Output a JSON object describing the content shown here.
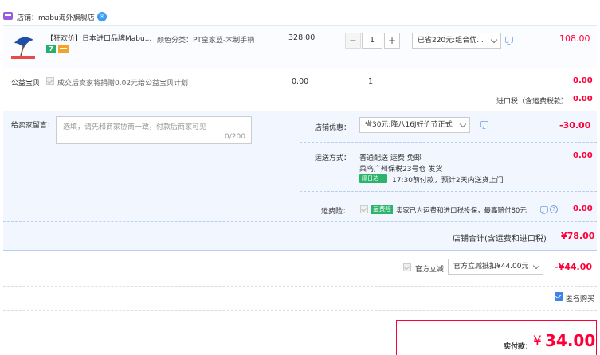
{
  "shop": {
    "label": "店铺：mabu海外旗舰店"
  },
  "item": {
    "title": "【狂欢价】日本进口品牌Mabu...",
    "sku": "颜色分类：PT皇家蓝-木制手柄",
    "unit_price": "328.00",
    "quantity": "1",
    "promo": "已省220元:组合优...",
    "total": "108.00",
    "tag_seven": "7"
  },
  "charity": {
    "label": "公益宝贝",
    "text": "成交后卖家将捐赠0.02元给公益宝贝计划",
    "price": "0.00",
    "qty": "1",
    "total": "0.00"
  },
  "tax": {
    "label": "进口税（含运费税款）",
    "value": "0.00"
  },
  "message": {
    "label": "给卖家留言：",
    "placeholder": "选填，请先和商家协商一致，付款后商家可见",
    "count": "0/200"
  },
  "coupon": {
    "label": "店铺优惠：",
    "selected": "省30元:降八16J好价节正式",
    "value": "-30.00"
  },
  "shipping": {
    "label": "运送方式：",
    "line1": "普通配送 运费 免邮",
    "line2": "菜鸟广州保税23号仓   发货",
    "badge": "隔日达",
    "line3": "17:30前付款，预计2天内送货上门",
    "value": "0.00"
  },
  "insurance": {
    "label": "运费险：",
    "badge": "运费险",
    "text": "卖家已为运费和进口税投保，最高赔付80元",
    "value": "0.00"
  },
  "shop_total": {
    "label": "店铺合计(含运费和进口税)",
    "value": "¥78.00"
  },
  "official_discount": {
    "label": "官方立减",
    "selected": "官方立减抵扣¥44.00元",
    "value": "-¥44.00"
  },
  "anonymous": {
    "label": "匿名购买"
  },
  "payment": {
    "label": "实付款：",
    "currency": "¥",
    "value": "34.00"
  },
  "colors": {
    "accent_red": "#ff0036",
    "panel_blue": "#f2f7ff",
    "badge_green": "#2db46b"
  }
}
